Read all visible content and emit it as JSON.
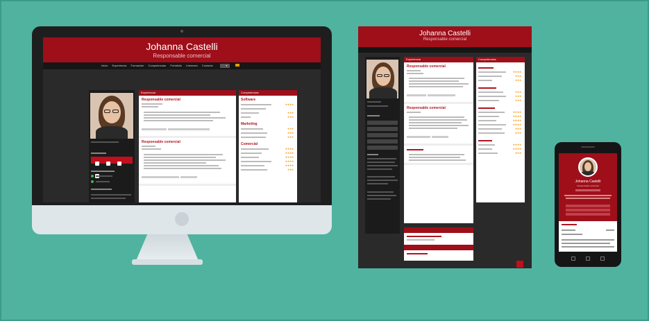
{
  "desktop": {
    "name": "Johanna Castelli",
    "role": "Responsable comercial",
    "nav": [
      "Inicio",
      "Experiencia",
      "Formación",
      "Competencias",
      "Portafolio",
      "Intereses",
      "Contacto"
    ],
    "experience_header": "Experiencia",
    "skills_header": "Competencias",
    "job_title": "Responsable comercial",
    "skill_groups": [
      "Software",
      "Marketing",
      "Comercial"
    ]
  },
  "tablet": {
    "name": "Johanna Castelli",
    "role": "Responsable comercial",
    "experience_header": "Experiencia",
    "skills_header": "Competencias",
    "job_title": "Responsable comercial"
  },
  "phone": {
    "name": "Johanna Castelli",
    "role": "Responsable comercial"
  },
  "colors": {
    "background": "#4fb3a0",
    "brand_red": "#9e0f1a",
    "dark": "#2a2a2a"
  }
}
